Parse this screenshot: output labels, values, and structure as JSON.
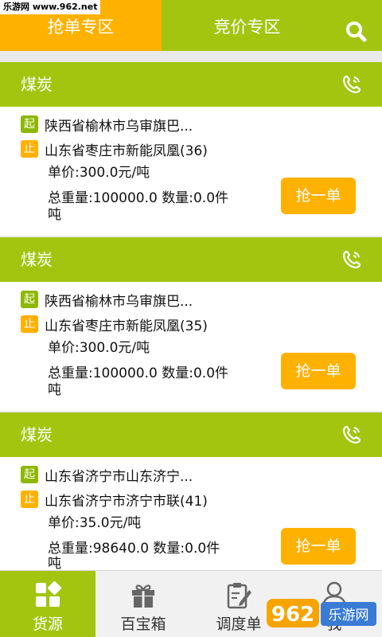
{
  "site_watermark": "乐游网 www.962.net",
  "tabs": [
    {
      "label": "抢单专区",
      "active": true
    },
    {
      "label": "竞价专区",
      "active": false
    }
  ],
  "search_icon": "search-icon",
  "cards": [
    {
      "category": "煤炭",
      "start_tag": "起",
      "start_place": "陕西省榆林市乌审旗巴...",
      "end_tag": "止",
      "end_place": "山东省枣庄市新能凤凰(36)",
      "unit_price": "单价:300.0元/吨",
      "weight_qty": "总重量:100000.0  数量:0.0件",
      "weight_unit": "吨",
      "button": "抢一单"
    },
    {
      "category": "煤炭",
      "start_tag": "起",
      "start_place": "陕西省榆林市乌审旗巴...",
      "end_tag": "止",
      "end_place": "山东省枣庄市新能凤凰(35)",
      "unit_price": "单价:300.0元/吨",
      "weight_qty": "总重量:100000.0  数量:0.0件",
      "weight_unit": "吨",
      "button": "抢一单"
    },
    {
      "category": "煤炭",
      "start_tag": "起",
      "start_place": "山东省济宁市山东济宁...",
      "end_tag": "止",
      "end_place": "山东省济宁市济宁市联(41)",
      "unit_price": "单价:35.0元/吨",
      "weight_qty": "总重量:98640.0    数量:0.0件",
      "weight_unit": "吨",
      "button": "抢一单"
    }
  ],
  "nav": [
    {
      "label": "货源",
      "icon": "grid-icon",
      "active": true
    },
    {
      "label": "百宝箱",
      "icon": "gift-icon",
      "active": false
    },
    {
      "label": "调度单",
      "icon": "clipboard-icon",
      "active": false
    },
    {
      "label": "我",
      "icon": "person-icon",
      "active": false
    }
  ],
  "bottom_watermark": "962 乐游网",
  "colors": {
    "green": "#a3c510",
    "orange": "#ffb100"
  }
}
